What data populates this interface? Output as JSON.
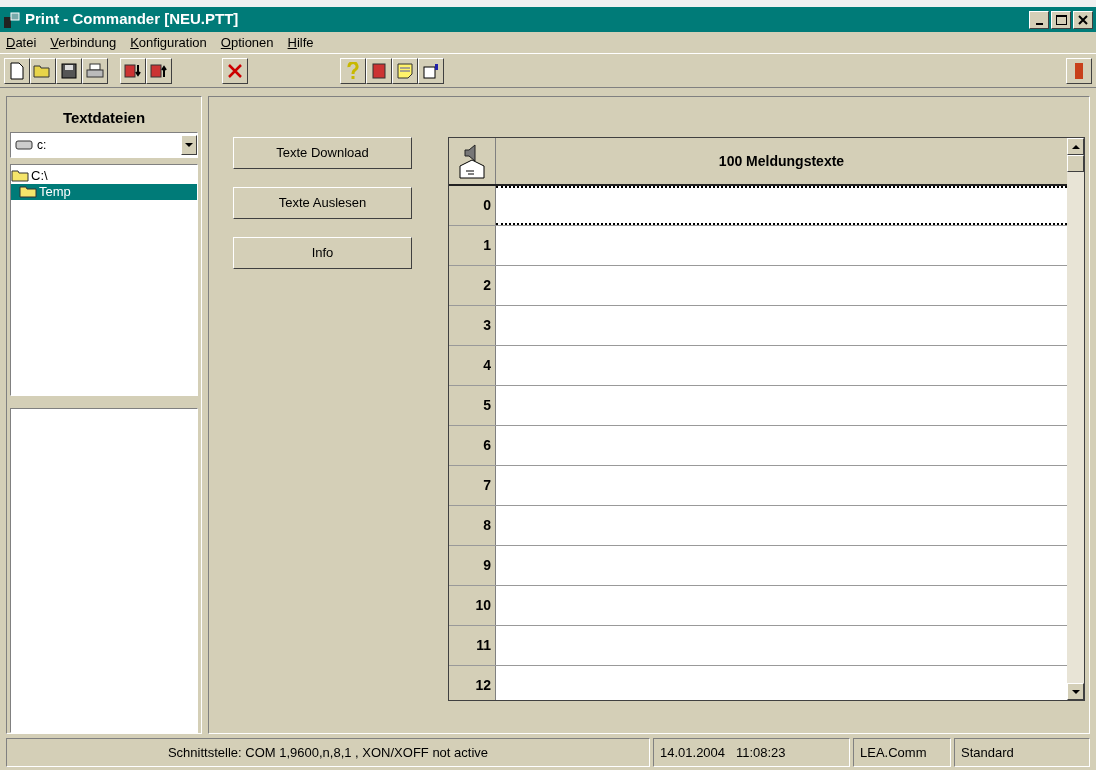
{
  "window": {
    "title": "Print - Commander [NEU.PTT]"
  },
  "menu": [
    "Datei",
    "Verbindung",
    "Konfiguration",
    "Optionen",
    "Hilfe"
  ],
  "sidebar": {
    "title": "Textdateien",
    "drive": "c:",
    "tree": [
      {
        "label": "C:\\",
        "selected": false,
        "children": [
          {
            "label": "Temp",
            "selected": true
          }
        ]
      }
    ]
  },
  "buttons": [
    "Texte Download",
    "Texte Auslesen",
    "Info"
  ],
  "table": {
    "header": "100 Meldungstexte",
    "rows": [
      {
        "number": "0",
        "focused": true
      },
      {
        "number": "1",
        "focused": false
      },
      {
        "number": "2",
        "focused": false
      },
      {
        "number": "3",
        "focused": false
      },
      {
        "number": "4",
        "focused": false
      },
      {
        "number": "5",
        "focused": false
      },
      {
        "number": "6",
        "focused": false
      },
      {
        "number": "7",
        "focused": false
      },
      {
        "number": "8",
        "focused": false
      },
      {
        "number": "9",
        "focused": false
      },
      {
        "number": "10",
        "focused": false
      },
      {
        "number": "11",
        "focused": false
      },
      {
        "number": "12",
        "focused": false
      }
    ]
  },
  "status_bar": [
    "Schnittstelle: COM 1,9600,n,8,1 , XON/XOFF not active",
    "14.01.2004   11:08:23",
    "LEA.Comm",
    "Standard"
  ]
}
